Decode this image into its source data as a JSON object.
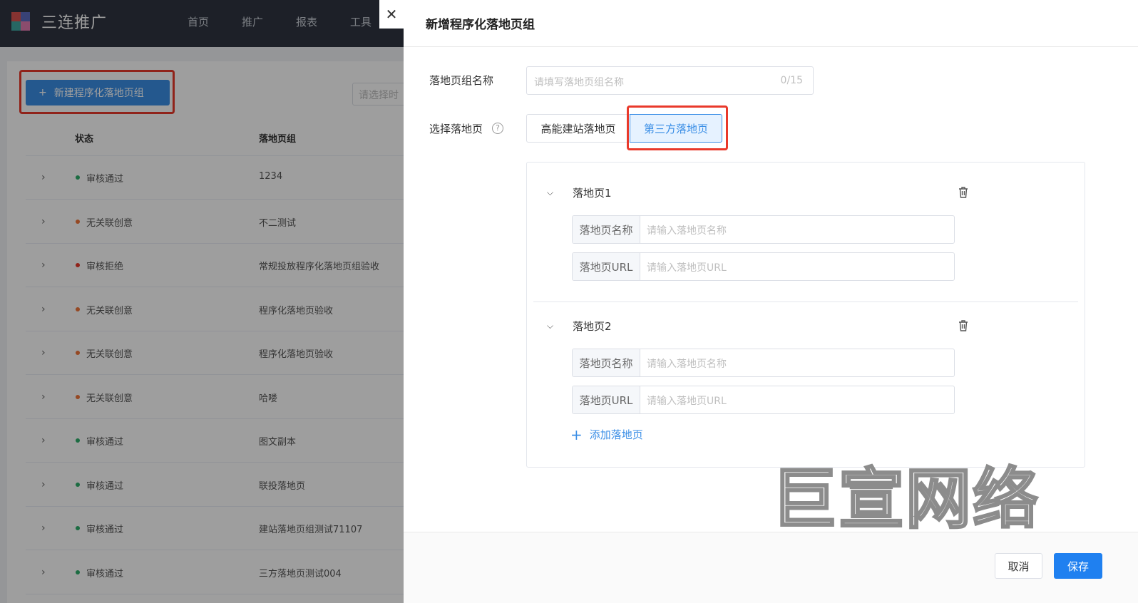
{
  "app": {
    "title": "三连推广",
    "nav": [
      "首页",
      "推广",
      "报表",
      "工具"
    ]
  },
  "list": {
    "new_button_label": "新建程序化落地页组",
    "filter_placeholder": "请选择时",
    "columns": {
      "status": "状态",
      "group": "落地页组"
    },
    "rows": [
      {
        "status": "审核通过",
        "status_color": "#2eae6b",
        "group": "1234"
      },
      {
        "status": "无关联创意",
        "status_color": "#f0763a",
        "group": "不二测试"
      },
      {
        "status": "审核拒绝",
        "status_color": "#e9392b",
        "group": "常规投放程序化落地页组验收"
      },
      {
        "status": "无关联创意",
        "status_color": "#f0763a",
        "group": "程序化落地页验收"
      },
      {
        "status": "无关联创意",
        "status_color": "#f0763a",
        "group": "程序化落地页验收"
      },
      {
        "status": "无关联创意",
        "status_color": "#f0763a",
        "group": "哈喽"
      },
      {
        "status": "审核通过",
        "status_color": "#2eae6b",
        "group": "图文副本"
      },
      {
        "status": "审核通过",
        "status_color": "#2eae6b",
        "group": "联投落地页"
      },
      {
        "status": "审核通过",
        "status_color": "#2eae6b",
        "group": "建站落地页组测试71107"
      },
      {
        "status": "审核通过",
        "status_color": "#2eae6b",
        "group": "三方落地页测试004"
      }
    ]
  },
  "drawer": {
    "close_glyph": "✕",
    "title": "新增程序化落地页组",
    "group_name": {
      "label": "落地页组名称",
      "placeholder": "请填写落地页组名称",
      "value": "",
      "counter": "0/15"
    },
    "select": {
      "label": "选择落地页",
      "help_glyph": "?",
      "options": [
        "高能建站落地页",
        "第三方落地页"
      ],
      "selected": "第三方落地页"
    },
    "landing_pages": [
      {
        "title": "落地页1",
        "name_label": "落地页名称",
        "name_placeholder": "请输入落地页名称",
        "url_label": "落地页URL",
        "url_placeholder": "请输入落地页URL"
      },
      {
        "title": "落地页2",
        "name_label": "落地页名称",
        "name_placeholder": "请输入落地页名称",
        "url_label": "落地页URL",
        "url_placeholder": "请输入落地页URL"
      }
    ],
    "add_label": "添加落地页",
    "cancel_label": "取消",
    "save_label": "保存"
  },
  "watermark": "巨宣网络",
  "colors": {
    "primary": "#3a8ee6",
    "save": "#1f80f0",
    "highlight": "#e9392b",
    "nav_bg": "#2f3541"
  }
}
